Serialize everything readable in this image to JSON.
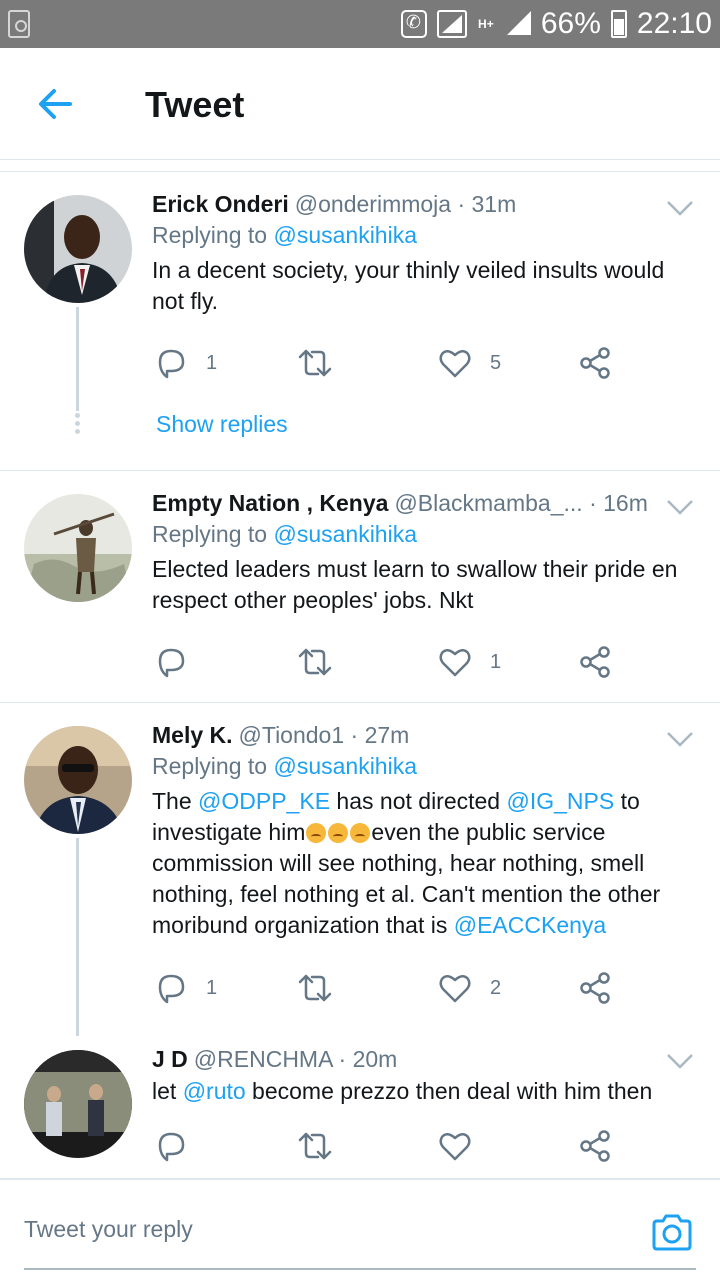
{
  "status_bar": {
    "battery": "66%",
    "time": "22:10",
    "network": "H+"
  },
  "header": {
    "title": "Tweet"
  },
  "accent": "#1da1f2",
  "tweets": [
    {
      "name": "Erick Onderi",
      "handle": "@onderimmoja",
      "time": "· 31m",
      "replying_prefix": "Replying to ",
      "replying_to": "@susankihika",
      "text": "In a decent society, your thinly veiled insults would not fly.",
      "replies": "1",
      "retweets": "",
      "likes": "5",
      "show_replies": "Show replies"
    },
    {
      "name": "Empty Nation , Kenya",
      "handle": "@Blackmamba_...",
      "time": "· 16m",
      "replying_prefix": "Replying to ",
      "replying_to": "@susankihika",
      "text": "Elected leaders must learn to swallow their pride en respect other peoples' jobs. Nkt",
      "replies": "",
      "retweets": "",
      "likes": "1"
    },
    {
      "name": "Mely K.",
      "handle": "@Tiondo1",
      "time": "· 27m",
      "replying_prefix": "Replying to ",
      "replying_to": "@susankihika",
      "text_parts": {
        "p1": "The ",
        "m1": "@ODPP_KE",
        "p2": " has not directed ",
        "m2": "@IG_NPS",
        "p3": " to investigate him",
        "p4": "even the public service commission will see nothing, hear nothing, smell nothing, feel nothing et al. Can't mention the other moribund organization that is ",
        "m3": "@EACCKenya"
      },
      "replies": "1",
      "retweets": "",
      "likes": "2"
    },
    {
      "name": "J D",
      "handle": "@RENCHMA",
      "time": "· 20m",
      "text_parts": {
        "p1": "let ",
        "m1": "@ruto",
        "p2": " become prezzo then deal with him then"
      },
      "replies": "",
      "retweets": "",
      "likes": ""
    }
  ],
  "reply_bar": {
    "placeholder": "Tweet your reply"
  }
}
